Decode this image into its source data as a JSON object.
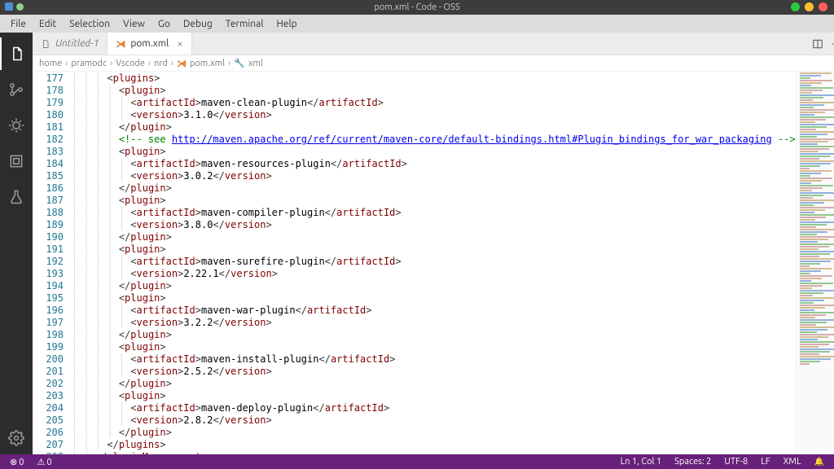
{
  "window": {
    "title": "pom.xml - Code - OSS"
  },
  "menu": [
    "File",
    "Edit",
    "Selection",
    "View",
    "Go",
    "Debug",
    "Terminal",
    "Help"
  ],
  "tabs": [
    {
      "label": "Untitled-1",
      "active": false
    },
    {
      "label": "pom.xml",
      "active": true
    }
  ],
  "breadcrumb": [
    "home",
    "pramodc",
    "Vscode",
    "nrd",
    "pom.xml",
    "xml"
  ],
  "status": {
    "errors": "0",
    "warnings": "0",
    "lncol": "Ln 1, Col 1",
    "spaces": "Spaces: 2",
    "encoding": "UTF-8",
    "eol": "LF",
    "lang": "XML"
  },
  "editor": {
    "first_line_no": 177,
    "comment_link": "http://maven.apache.org/ref/current/maven-core/default-bindings.html#Plugin_bindings_for_war_packaging",
    "lines": [
      {
        "i": 0,
        "tag_open": "plugins"
      },
      {
        "i": 1,
        "tag_open": "plugin"
      },
      {
        "i": 2,
        "tag": "artifactId",
        "text": "maven-clean-plugin"
      },
      {
        "i": 2,
        "tag": "version",
        "text": "3.1.0"
      },
      {
        "i": 1,
        "tag_close": "plugin"
      },
      {
        "i": 1,
        "comment": true
      },
      {
        "i": 1,
        "tag_open": "plugin"
      },
      {
        "i": 2,
        "tag": "artifactId",
        "text": "maven-resources-plugin"
      },
      {
        "i": 2,
        "tag": "version",
        "text": "3.0.2"
      },
      {
        "i": 1,
        "tag_close": "plugin"
      },
      {
        "i": 1,
        "tag_open": "plugin"
      },
      {
        "i": 2,
        "tag": "artifactId",
        "text": "maven-compiler-plugin"
      },
      {
        "i": 2,
        "tag": "version",
        "text": "3.8.0"
      },
      {
        "i": 1,
        "tag_close": "plugin"
      },
      {
        "i": 1,
        "tag_open": "plugin"
      },
      {
        "i": 2,
        "tag": "artifactId",
        "text": "maven-surefire-plugin"
      },
      {
        "i": 2,
        "tag": "version",
        "text": "2.22.1"
      },
      {
        "i": 1,
        "tag_close": "plugin"
      },
      {
        "i": 1,
        "tag_open": "plugin"
      },
      {
        "i": 2,
        "tag": "artifactId",
        "text": "maven-war-plugin"
      },
      {
        "i": 2,
        "tag": "version",
        "text": "3.2.2"
      },
      {
        "i": 1,
        "tag_close": "plugin"
      },
      {
        "i": 1,
        "tag_open": "plugin"
      },
      {
        "i": 2,
        "tag": "artifactId",
        "text": "maven-install-plugin"
      },
      {
        "i": 2,
        "tag": "version",
        "text": "2.5.2"
      },
      {
        "i": 1,
        "tag_close": "plugin"
      },
      {
        "i": 1,
        "tag_open": "plugin"
      },
      {
        "i": 2,
        "tag": "artifactId",
        "text": "maven-deploy-plugin"
      },
      {
        "i": 2,
        "tag": "version",
        "text": "2.8.2"
      },
      {
        "i": 1,
        "tag_close": "plugin"
      },
      {
        "i": 0,
        "tag_close": "plugins"
      },
      {
        "i": -1,
        "tag_close": "pluginManagement"
      }
    ]
  },
  "minimap_palette": [
    "#b86b6b",
    "#3a9c3a",
    "#3a74c4",
    "#b8873a"
  ],
  "activity_icons": [
    "files",
    "source-control",
    "extensions",
    "debug",
    "run",
    "test",
    "settings"
  ]
}
